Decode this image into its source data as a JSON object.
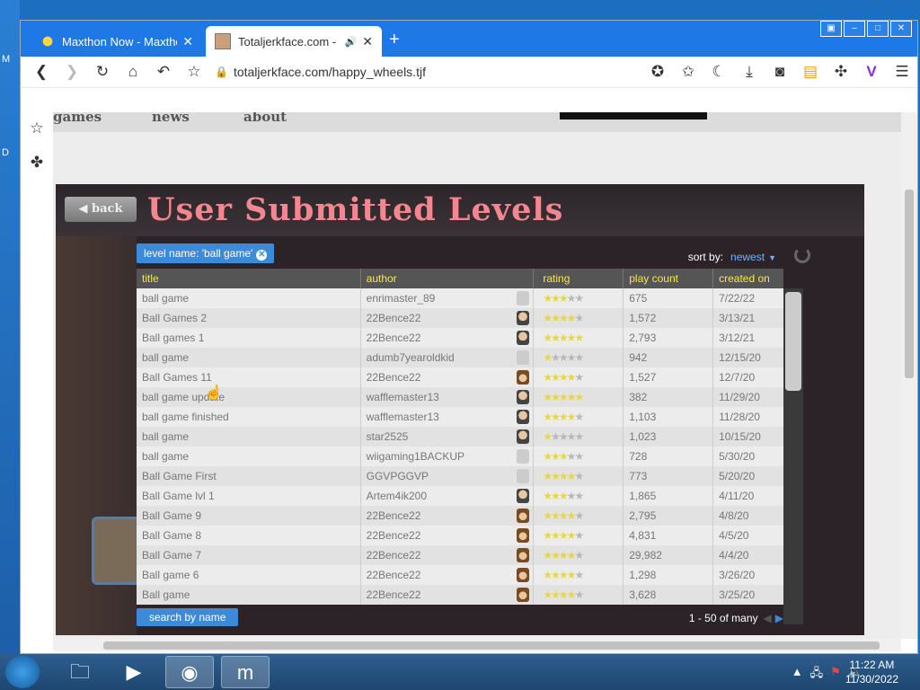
{
  "browser": {
    "tabs": [
      {
        "title": "Maxthon Now - Maxtho",
        "icon": "sun-icon"
      },
      {
        "title": "Totaljerkface.com -",
        "icon": "site-favicon",
        "audio": true
      }
    ],
    "url": "totaljerkface.com/happy_wheels.tjf"
  },
  "site_nav": {
    "games": "games",
    "news": "news",
    "about": "about"
  },
  "game": {
    "back_label": "back",
    "title": "User Submitted Levels",
    "filter_label": "level name: 'ball game'",
    "sort_label": "sort by:",
    "sort_value": "newest",
    "columns": {
      "title": "title",
      "author": "author",
      "rating": "rating",
      "play_count": "play count",
      "created_on": "created on"
    },
    "search_label": "search by name",
    "paging": "1 - 50 of many"
  },
  "levels": [
    {
      "title": "ball game",
      "author": "enrimaster_89",
      "avatar": "blank",
      "rating": 2.5,
      "plays": "675",
      "created": "7/22/22"
    },
    {
      "title": "Ball Games 2",
      "author": "22Bence22",
      "avatar": "man",
      "rating": 3.5,
      "plays": "1,572",
      "created": "3/13/21"
    },
    {
      "title": "Ball games 1",
      "author": "22Bence22",
      "avatar": "man",
      "rating": 4.5,
      "plays": "2,793",
      "created": "3/12/21"
    },
    {
      "title": "ball game",
      "author": "adumb7yearoldkid",
      "avatar": "blank",
      "rating": 1,
      "plays": "942",
      "created": "12/15/20"
    },
    {
      "title": "Ball Games 11",
      "author": "22Bence22",
      "avatar": "hat",
      "rating": 3.5,
      "plays": "1,527",
      "created": "12/7/20"
    },
    {
      "title": "ball game update",
      "author": "wafflemaster13",
      "avatar": "man",
      "rating": 5,
      "plays": "382",
      "created": "11/29/20"
    },
    {
      "title": "ball game finished",
      "author": "wafflemaster13",
      "avatar": "man",
      "rating": 4,
      "plays": "1,103",
      "created": "11/28/20"
    },
    {
      "title": "ball game",
      "author": "star2525",
      "avatar": "man",
      "rating": 1,
      "plays": "1,023",
      "created": "10/15/20"
    },
    {
      "title": "ball game",
      "author": "wiigaming1BACKUP",
      "avatar": "blank",
      "rating": 2.5,
      "plays": "728",
      "created": "5/30/20"
    },
    {
      "title": "Ball Game First",
      "author": "GGVPGGVP",
      "avatar": "blank",
      "rating": 3.5,
      "plays": "773",
      "created": "5/20/20"
    },
    {
      "title": "Ball Game lvl 1",
      "author": "Artem4ik200",
      "avatar": "man",
      "rating": 2.5,
      "plays": "1,865",
      "created": "4/11/20"
    },
    {
      "title": "Ball Game 9",
      "author": "22Bence22",
      "avatar": "hat",
      "rating": 4,
      "plays": "2,795",
      "created": "4/8/20"
    },
    {
      "title": "Ball Game 8",
      "author": "22Bence22",
      "avatar": "hat",
      "rating": 4,
      "plays": "4,831",
      "created": "4/5/20"
    },
    {
      "title": "Ball Game 7",
      "author": "22Bence22",
      "avatar": "hat",
      "rating": 4,
      "plays": "29,982",
      "created": "4/4/20"
    },
    {
      "title": "Ball game 6",
      "author": "22Bence22",
      "avatar": "hat",
      "rating": 3.5,
      "plays": "1,298",
      "created": "3/26/20"
    },
    {
      "title": "Ball game",
      "author": "22Bence22",
      "avatar": "hat",
      "rating": 4,
      "plays": "3,628",
      "created": "3/25/20"
    }
  ],
  "taskbar": {
    "time": "11:22 AM",
    "date": "11/30/2022"
  }
}
